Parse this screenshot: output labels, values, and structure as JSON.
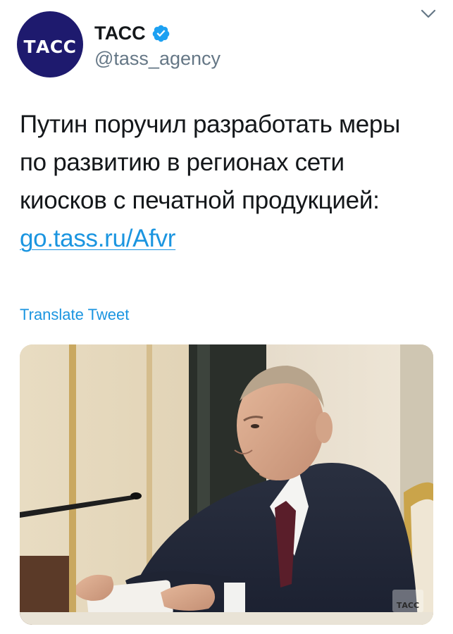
{
  "header": {
    "avatar_text": "ТАСС",
    "display_name": "ТАСС",
    "handle": "@tass_agency",
    "verified_icon": "verified-badge-icon",
    "menu_icon": "chevron-down-icon"
  },
  "tweet": {
    "text_lines": [
      "Путин поручил разработать меры",
      "по развитию в регионах сети",
      "киосков с печатной продукцией:"
    ],
    "link": "go.tass.ru/Afvr",
    "translate_label": "Translate Tweet"
  },
  "media": {
    "watermark": "ТАСС"
  },
  "colors": {
    "link": "#1b95e0",
    "avatar_bg": "#1e1a6e",
    "verified": "#1da1f2",
    "handle": "#657786"
  }
}
